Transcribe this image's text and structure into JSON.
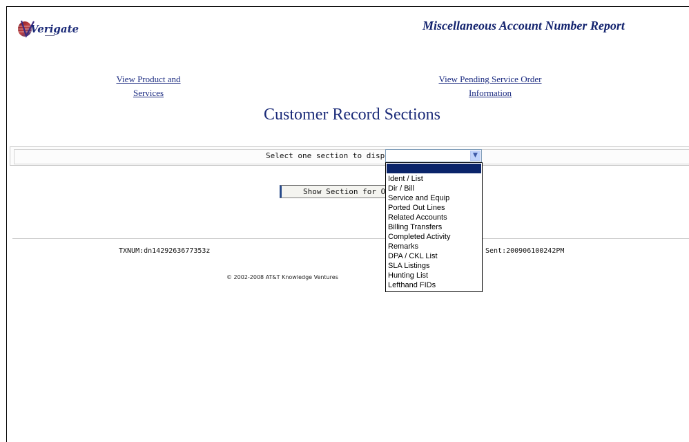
{
  "header": {
    "logo_text": "Verigate",
    "report_title": "Miscellaneous Account Number Report"
  },
  "nav": {
    "product_line1": "View Product and",
    "product_line2": "Services",
    "pending_line1": "View Pending Service Order",
    "pending_line2": "Information"
  },
  "main": {
    "section_title": "Customer Record Sections",
    "select_label": "Select one section to display",
    "select_value": "",
    "show_button_label": "Show Section for Op"
  },
  "dropdown": {
    "options": [
      "",
      "Ident / List",
      "Dir / Bill",
      "Service and Equip",
      "Ported Out Lines",
      "Related Accounts",
      "Billing Transfers",
      "Completed Activity",
      "Remarks",
      "DPA / CKL List",
      "SLA Listings",
      "Hunting List",
      "Lefthand FIDs"
    ],
    "selected_index": 0
  },
  "footer": {
    "txnum": "TXNUM:dn1429263677353z",
    "sent": "Sent:200906100242PM",
    "copyright": "© 2002-2008 AT&T Knowledge Ventures"
  },
  "colors": {
    "title_blue": "#13236e",
    "link_blue": "#1a2a80",
    "dropdown_highlight": "#0a246a"
  },
  "icons": {
    "logo": "verigate-logo-icon",
    "select_arrow": "chevron-down-icon"
  }
}
